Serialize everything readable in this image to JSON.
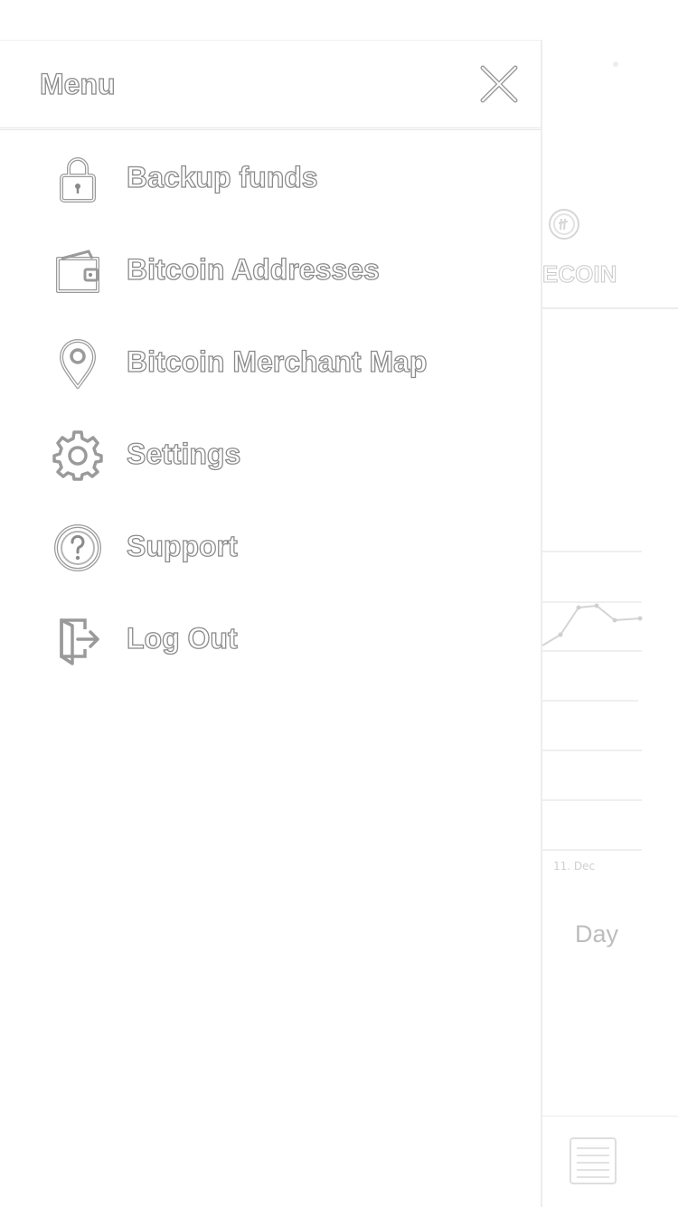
{
  "menu": {
    "title": "Menu",
    "items": [
      {
        "label": "Backup funds",
        "icon": "lock-icon"
      },
      {
        "label": "Bitcoin Addresses",
        "icon": "wallet-icon"
      },
      {
        "label": "Bitcoin Merchant Map",
        "icon": "map-pin-icon"
      },
      {
        "label": "Settings",
        "icon": "gear-icon"
      },
      {
        "label": "Support",
        "icon": "question-circle-icon"
      },
      {
        "label": "Log Out",
        "icon": "logout-door-icon"
      }
    ]
  },
  "background": {
    "coin_tab_label": "ECOIN",
    "chart_x_tick": "11. Dec",
    "time_range_label": "Day"
  }
}
